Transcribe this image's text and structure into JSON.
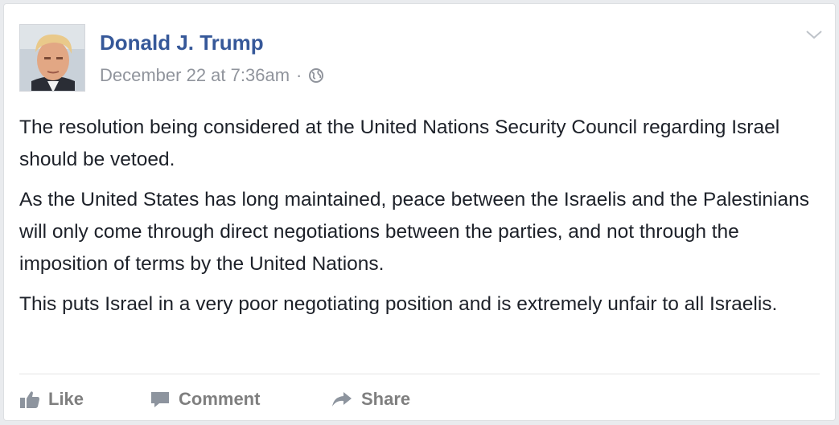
{
  "post": {
    "author": "Donald J. Trump",
    "timestamp": "December 22 at 7:36am",
    "separator": "·",
    "privacy_icon": "globe-icon",
    "menu_icon": "chevron-down-icon",
    "paragraphs": [
      "The resolution being considered at the United Nations Security Council regarding Israel should be vetoed.",
      "As the United States has long maintained, peace between the Israelis and the Palestinians will only come through direct negotiations between the parties, and not through the imposition of terms by the United Nations.",
      "This puts Israel in a very poor negotiating position and is extremely unfair to all Israelis."
    ]
  },
  "actions": {
    "like_label": "Like",
    "comment_label": "Comment",
    "share_label": "Share"
  },
  "colors": {
    "author": "#365899",
    "meta": "#90949c",
    "text": "#1d2129",
    "action": "#7f7f7f"
  }
}
